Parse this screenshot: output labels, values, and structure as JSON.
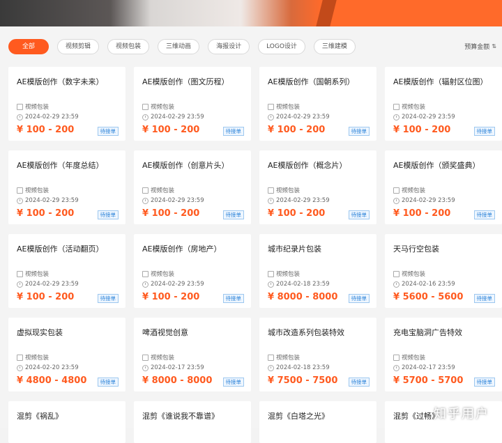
{
  "filters": [
    "全部",
    "视频剪辑",
    "视频包装",
    "三维动画",
    "海报设计",
    "LOGO设计",
    "三维建模"
  ],
  "sort_label": "预算金额",
  "sort_icon": "sort-arrows-icon",
  "cards": [
    {
      "title": "AE模版创作（数字未来）",
      "category": "视频包装",
      "date": "2024-02-29 23:59",
      "price": "¥ 100 - 200",
      "status": "待接单"
    },
    {
      "title": "AE模版创作（图文历程）",
      "category": "视频包装",
      "date": "2024-02-29 23:59",
      "price": "¥ 100 - 200",
      "status": "待接单"
    },
    {
      "title": "AE模版创作（国朝系列）",
      "category": "视频包装",
      "date": "2024-02-29 23:59",
      "price": "¥ 100 - 200",
      "status": "待接单"
    },
    {
      "title": "AE模版创作（辐射区位图）",
      "category": "视频包装",
      "date": "2024-02-29 23:59",
      "price": "¥ 100 - 200",
      "status": "待接单"
    },
    {
      "title": "AE模版创作（年度总结）",
      "category": "视频包装",
      "date": "2024-02-29 23:59",
      "price": "¥ 100 - 200",
      "status": "待接单"
    },
    {
      "title": "AE模版创作（创意片头）",
      "category": "视频包装",
      "date": "2024-02-29 23:59",
      "price": "¥ 100 - 200",
      "status": "待接单"
    },
    {
      "title": "AE模版创作（概念片）",
      "category": "视频包装",
      "date": "2024-02-29 23:59",
      "price": "¥ 100 - 200",
      "status": "待接单"
    },
    {
      "title": "AE模版创作（颁奖盛典）",
      "category": "视频包装",
      "date": "2024-02-29 23:59",
      "price": "¥ 100 - 200",
      "status": "待接单"
    },
    {
      "title": "AE模版创作（活动翻页）",
      "category": "视频包装",
      "date": "2024-02-29 23:59",
      "price": "¥ 100 - 200",
      "status": "待接单"
    },
    {
      "title": "AE模版创作（房地产）",
      "category": "视频包装",
      "date": "2024-02-29 23:59",
      "price": "¥ 100 - 200",
      "status": "待接单"
    },
    {
      "title": "城市纪录片包装",
      "category": "视频包装",
      "date": "2024-02-18 23:59",
      "price": "¥ 8000 - 8000",
      "status": "待接单"
    },
    {
      "title": "天马行空包装",
      "category": "视频包装",
      "date": "2024-02-16 23:59",
      "price": "¥ 5600 - 5600",
      "status": "待接单"
    },
    {
      "title": "虚拟现实包装",
      "category": "视频包装",
      "date": "2024-02-20 23:59",
      "price": "¥ 4800 - 4800",
      "status": "待接单"
    },
    {
      "title": "啤酒视觉创意",
      "category": "视频包装",
      "date": "2024-02-17 23:59",
      "price": "¥ 8000 - 8000",
      "status": "待接单"
    },
    {
      "title": "城市改造系列包装特效",
      "category": "视频包装",
      "date": "2024-02-18 23:59",
      "price": "¥ 7500 - 7500",
      "status": "待接单"
    },
    {
      "title": "充电宝脑洞广告特效",
      "category": "视频包装",
      "date": "2024-02-17 23:59",
      "price": "¥ 5700 - 5700",
      "status": "待接单"
    }
  ],
  "partial_cards": [
    "混剪《祸乱》",
    "混剪《谁说我不靠谱》",
    "混剪《白塔之光》",
    "混剪《过畅》"
  ],
  "watermark": "知乎用户",
  "colors": {
    "accent": "#ff5a1f",
    "badge": "#2a82d8"
  }
}
